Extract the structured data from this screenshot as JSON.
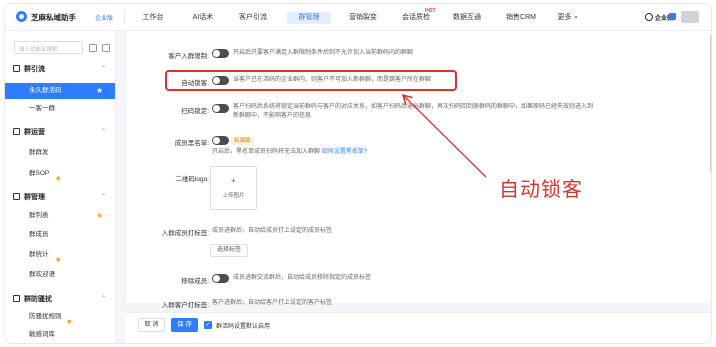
{
  "app": {
    "brand": "芝麻私域助手",
    "brand_sub": "企业版"
  },
  "nav": [
    {
      "label": "工作台"
    },
    {
      "label": "AI话术"
    },
    {
      "label": "客户引流"
    },
    {
      "label": "群管理",
      "active": true
    },
    {
      "label": "营销裂变"
    },
    {
      "label": "会话质检",
      "badge": "HOT"
    },
    {
      "label": "数据互通"
    },
    {
      "label": "销售CRM"
    },
    {
      "label": "更多"
    }
  ],
  "user": {
    "name": "企业微"
  },
  "sidebar": {
    "search_placeholder": "输入功能名搜索",
    "groups": [
      {
        "title": "群引流",
        "items": [
          {
            "label": "永久群活码",
            "active": true
          },
          {
            "label": "一客一群"
          }
        ]
      },
      {
        "title": "群运营",
        "items": [
          {
            "label": "群群发"
          },
          {
            "label": "群SOP"
          }
        ]
      },
      {
        "title": "群管理",
        "items": [
          {
            "label": "群列表"
          },
          {
            "label": "群成员"
          },
          {
            "label": "群统计"
          },
          {
            "label": "群欢迎语"
          }
        ]
      },
      {
        "title": "群防骚扰",
        "items": [
          {
            "label": "防骚扰规则"
          },
          {
            "label": "敏感词库"
          }
        ]
      }
    ]
  },
  "form": {
    "rows": [
      {
        "label": "客户入群限制:",
        "desc": "开启后只要客户满足入群限制条件后则不允许加入当前群码内的群聊"
      },
      {
        "label": "自动锁客:",
        "desc": "当客户已在活码的企业群内，则客户不可加入新群聊，而是跳客户所在群聊"
      },
      {
        "label": "扫码锁定:",
        "desc": "客户扫码后系统将锁定当前群码与客户的对应关系，如客户扫码后退出群聊，再次扫码回到原群码的群聊中，如果原码已经失效则进入到新群聊中，不影响客户的信息"
      },
      {
        "label": "成员黑名单:",
        "badge": "标准版",
        "desc": "开启后，黑名单成员扫码将无法加入群聊",
        "link": "如何设置黑名单?"
      },
      {
        "label": "二维码logo:",
        "upload_label": "上传图片"
      },
      {
        "label": "入群成员打标签:",
        "desc": "成员进群后，自动给成员打上设定的成员标签",
        "button": "选择标签"
      },
      {
        "label": "移除成员:",
        "desc": "成员进群交流群后，自动给成员移除指定的成员标签"
      },
      {
        "label": "入群客户打标签:",
        "desc": "客户进群后，自动给客户打上设定的客户标签"
      }
    ]
  },
  "footer": {
    "cancel": "取 消",
    "save": "保 存",
    "checkbox_label": "群活码设置默认启用"
  },
  "annotation": {
    "text": "自动锁客",
    "color": "#d9342b"
  },
  "colors": {
    "accent": "#2f7dff",
    "highlight": "#d9342b",
    "warning": "#f5a623"
  }
}
